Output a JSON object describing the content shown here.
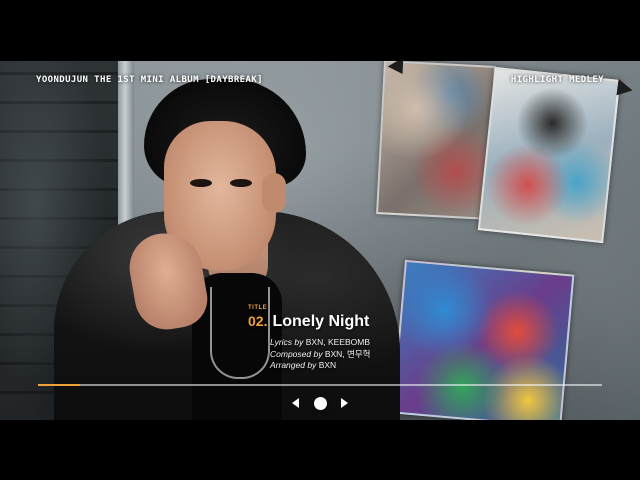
{
  "header": {
    "album_title": "YOONDUJUN THE 1ST MINI ALBUM [DAYBREAK]",
    "medley_label": "HIGHLIGHT MEDLEY"
  },
  "track": {
    "tag": "TITLE",
    "number": "02.",
    "name": "Lonely Night",
    "credits": [
      {
        "role": "Lyrics by",
        "names": "BXN, KEEBOMB"
      },
      {
        "role": "Composed by",
        "names": "BXN, 변무혁"
      },
      {
        "role": "Arranged by",
        "names": "BXN"
      }
    ]
  },
  "player": {
    "progress_fraction": 0.075,
    "prev_icon": "triangle-left-icon",
    "indicator_icon": "dot-icon",
    "next_icon": "triangle-right-icon"
  },
  "colors": {
    "accent": "#f0a23a",
    "letterbox": "#000000",
    "text": "#ffffff"
  }
}
